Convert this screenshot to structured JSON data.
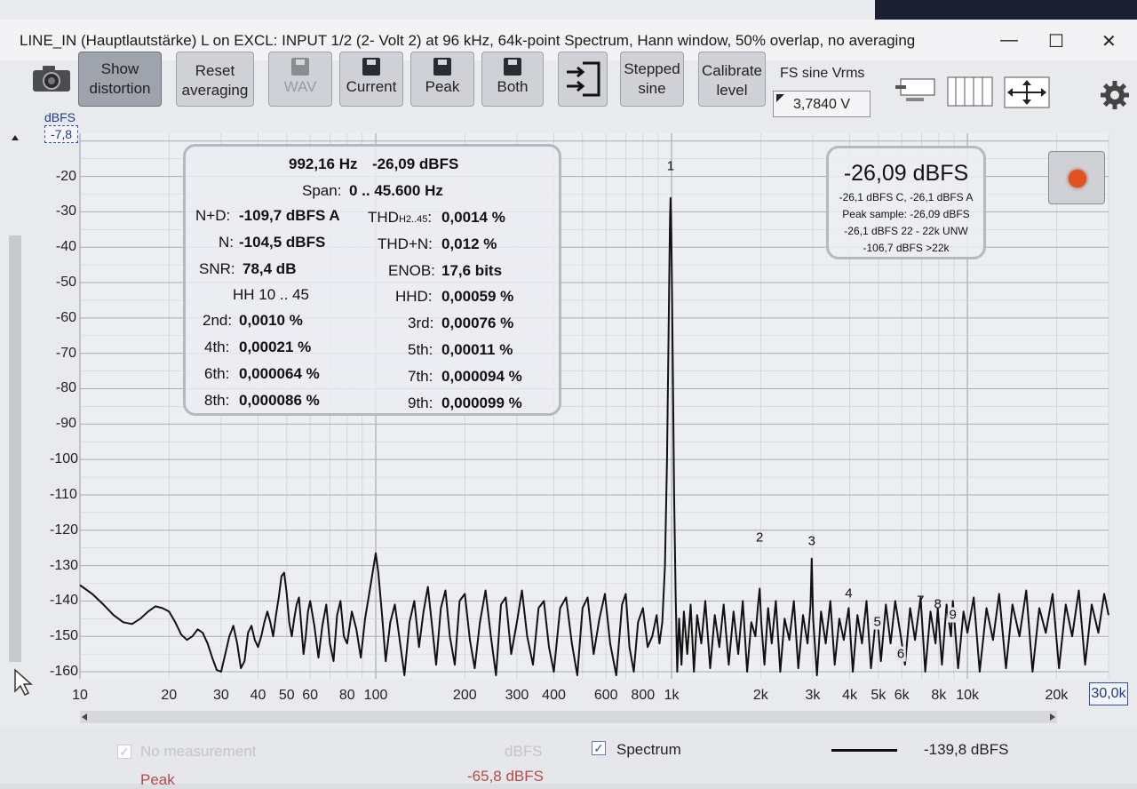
{
  "window": {
    "title": "LINE_IN (Hauptlautstärke) L on EXCL: INPUT 1/2 (2- Volt 2) at 96 kHz, 64k-point Spectrum, Hann window, 50% overlap, no averaging",
    "minimize": "—",
    "maximize": "☐",
    "close": "✕"
  },
  "toolbar": {
    "show_distortion": [
      "Show",
      "distortion"
    ],
    "reset_averaging": [
      "Reset",
      "averaging"
    ],
    "wav": "WAV",
    "current": "Current",
    "peak": "Peak",
    "both": "Both",
    "stepped_sine": [
      "Stepped",
      "sine"
    ],
    "calibrate_level": [
      "Calibrate",
      "level"
    ],
    "fs_label": "FS sine Vrms",
    "fs_value": "3,7840 V"
  },
  "chart_axis": {
    "y_unit": "dBFS",
    "y_top_value": "-7,8",
    "x_max_value": "30,0k"
  },
  "info": {
    "freq": "992,16 Hz",
    "level": "-26,09 dBFS",
    "span_label": "Span:",
    "span_value": "0 .. 45.600 Hz",
    "nd_label": "N+D:",
    "nd_value": "-109,7 dBFS A",
    "thd_label": "THD",
    "thd_sub": "H2..45",
    "thd_value": "0,0014 %",
    "n_label": "N:",
    "n_value": "-104,5 dBFS",
    "thdn_label": "THD+N:",
    "thdn_value": "0,012 %",
    "snr_label": "SNR:",
    "snr_value": "78,4 dB",
    "enob_label": "ENOB:",
    "enob_value": "17,6 bits",
    "hh_label": "HH 10 .. 45",
    "hhd_label": "HHD:",
    "hhd_value": "0,00059 %",
    "h2_label": "2nd:",
    "h2_value": "0,0010 %",
    "h3_label": "3rd:",
    "h3_value": "0,00076 %",
    "h4_label": "4th:",
    "h4_value": "0,00021 %",
    "h5_label": "5th:",
    "h5_value": "0,00011 %",
    "h6_label": "6th:",
    "h6_value": "0,000064 %",
    "h7_label": "7th:",
    "h7_value": "0,000094 %",
    "h8_label": "8th:",
    "h8_value": "0,000086 %",
    "h9_label": "9th:",
    "h9_value": "0,000099 %"
  },
  "peak_panel": {
    "main": "-26,09 dBFS",
    "line1": "-26,1 dBFS C, -26,1 dBFS A",
    "line2": "Peak sample: -26,09 dBFS",
    "line3": "-26,1 dBFS 22 - 22k UNW",
    "line4": "-106,7 dBFS >22k"
  },
  "footer": {
    "no_measurement": "No measurement",
    "dbfs_dim": "dBFS",
    "peak": "Peak",
    "peak_value": "-65,8 dBFS",
    "spectrum": "Spectrum",
    "spectrum_value": "-139,8 dBFS"
  },
  "chart_data": {
    "type": "line",
    "xscale": "log",
    "xlim": [
      10,
      30000
    ],
    "ylim": [
      -162,
      -7.8
    ],
    "x_ticks": [
      "10",
      "20",
      "30",
      "40",
      "50",
      "60",
      "80",
      "100",
      "200",
      "300",
      "400",
      "600",
      "800",
      "1k",
      "2k",
      "3k",
      "4k",
      "5k",
      "6k",
      "8k",
      "10k",
      "20k"
    ],
    "x_tick_values": [
      10,
      20,
      30,
      40,
      50,
      60,
      80,
      100,
      200,
      300,
      400,
      600,
      800,
      1000,
      2000,
      3000,
      4000,
      5000,
      6000,
      8000,
      10000,
      20000
    ],
    "y_ticks": [
      "-20",
      "-30",
      "-40",
      "-50",
      "-60",
      "-70",
      "-80",
      "-90",
      "-100",
      "-110",
      "-120",
      "-130",
      "-140",
      "-150",
      "-160"
    ],
    "y_tick_values": [
      -20,
      -30,
      -40,
      -50,
      -60,
      -70,
      -80,
      -90,
      -100,
      -110,
      -120,
      -130,
      -140,
      -150,
      -160
    ],
    "grid": true,
    "colors": {
      "trace": "#111111",
      "grid_major": "#a9acb3",
      "grid_minor": "#cfd1d6",
      "background": "#eceef1"
    },
    "harmonics": [
      {
        "label": "1",
        "x": 992,
        "y": -26.09,
        "marker_y": -17,
        "box": false
      },
      {
        "label": "2",
        "x": 1984,
        "y": -136.5,
        "marker_y": -122,
        "box": false
      },
      {
        "label": "3",
        "x": 2976,
        "y": -138,
        "marker_y": -123,
        "box": false
      },
      {
        "label": "4",
        "x": 3968,
        "y": -142,
        "marker_y": -138,
        "box": false
      },
      {
        "label": "5",
        "x": 4960,
        "y": -145,
        "marker_y": -146,
        "box": true
      },
      {
        "label": "6",
        "x": 5952,
        "y": -150,
        "marker_y": -155,
        "box": true
      },
      {
        "label": "7",
        "x": 6944,
        "y": -142,
        "marker_y": -140,
        "box": false
      },
      {
        "label": "8",
        "x": 7936,
        "y": -142,
        "marker_y": -141,
        "box": false
      },
      {
        "label": "9",
        "x": 8928,
        "y": -141,
        "marker_y": -144,
        "box": true
      }
    ],
    "series": [
      {
        "points": [
          [
            10,
            -135.5
          ],
          [
            11,
            -138
          ],
          [
            12,
            -141
          ],
          [
            13,
            -144
          ],
          [
            14,
            -146
          ],
          [
            15,
            -146.5
          ],
          [
            16,
            -145
          ],
          [
            17,
            -143
          ],
          [
            18,
            -141.5
          ],
          [
            19,
            -142
          ],
          [
            20,
            -143
          ],
          [
            21,
            -146
          ],
          [
            22,
            -149.5
          ],
          [
            23,
            -151
          ],
          [
            24,
            -150
          ],
          [
            25,
            -148
          ],
          [
            26,
            -149
          ],
          [
            27,
            -152
          ],
          [
            28,
            -156
          ],
          [
            29,
            -159.5
          ],
          [
            30,
            -160
          ],
          [
            31,
            -155
          ],
          [
            32,
            -150
          ],
          [
            33,
            -147
          ],
          [
            34,
            -152
          ],
          [
            35,
            -159
          ],
          [
            36,
            -157
          ],
          [
            37,
            -149
          ],
          [
            38,
            -147
          ],
          [
            39,
            -151
          ],
          [
            40,
            -153
          ],
          [
            41,
            -150
          ],
          [
            42,
            -146
          ],
          [
            43,
            -143
          ],
          [
            44,
            -146
          ],
          [
            45,
            -150
          ],
          [
            46,
            -144
          ],
          [
            47,
            -139
          ],
          [
            48,
            -133
          ],
          [
            49,
            -132
          ],
          [
            50,
            -138
          ],
          [
            51,
            -146
          ],
          [
            52,
            -150
          ],
          [
            53,
            -145
          ],
          [
            54,
            -141
          ],
          [
            55,
            -139
          ],
          [
            56,
            -147
          ],
          [
            57,
            -155
          ],
          [
            58,
            -150
          ],
          [
            59,
            -143
          ],
          [
            60,
            -140
          ],
          [
            62,
            -147
          ],
          [
            64,
            -156
          ],
          [
            66,
            -147
          ],
          [
            68,
            -141
          ],
          [
            70,
            -152
          ],
          [
            72,
            -157
          ],
          [
            74,
            -144
          ],
          [
            76,
            -140
          ],
          [
            78,
            -150
          ],
          [
            80,
            -152
          ],
          [
            83,
            -143
          ],
          [
            86,
            -148
          ],
          [
            89,
            -156
          ],
          [
            92,
            -145
          ],
          [
            95,
            -138
          ],
          [
            98,
            -131
          ],
          [
            100,
            -126.5
          ],
          [
            102,
            -132
          ],
          [
            105,
            -144
          ],
          [
            108,
            -157
          ],
          [
            112,
            -146
          ],
          [
            116,
            -141
          ],
          [
            120,
            -150
          ],
          [
            125,
            -161
          ],
          [
            130,
            -146
          ],
          [
            135,
            -140
          ],
          [
            140,
            -153
          ],
          [
            145,
            -143
          ],
          [
            150,
            -136
          ],
          [
            155,
            -147
          ],
          [
            160,
            -158
          ],
          [
            166,
            -142
          ],
          [
            172,
            -137
          ],
          [
            178,
            -150
          ],
          [
            185,
            -158
          ],
          [
            192,
            -140
          ],
          [
            200,
            -138
          ],
          [
            208,
            -151
          ],
          [
            216,
            -159
          ],
          [
            225,
            -146
          ],
          [
            235,
            -137
          ],
          [
            245,
            -150
          ],
          [
            255,
            -161
          ],
          [
            265,
            -141
          ],
          [
            275,
            -139
          ],
          [
            287,
            -155
          ],
          [
            300,
            -146
          ],
          [
            312,
            -137
          ],
          [
            325,
            -150
          ],
          [
            340,
            -158
          ],
          [
            355,
            -142
          ],
          [
            370,
            -140
          ],
          [
            385,
            -153
          ],
          [
            400,
            -160
          ],
          [
            420,
            -142
          ],
          [
            440,
            -139
          ],
          [
            460,
            -152
          ],
          [
            480,
            -161
          ],
          [
            500,
            -142
          ],
          [
            520,
            -139
          ],
          [
            545,
            -155
          ],
          [
            570,
            -145
          ],
          [
            595,
            -138
          ],
          [
            620,
            -152
          ],
          [
            650,
            -161
          ],
          [
            680,
            -141
          ],
          [
            700,
            -138
          ],
          [
            720,
            -153
          ],
          [
            745,
            -160
          ],
          [
            770,
            -146
          ],
          [
            800,
            -142
          ],
          [
            830,
            -153
          ],
          [
            860,
            -150
          ],
          [
            890,
            -144
          ],
          [
            910,
            -152
          ],
          [
            930,
            -146
          ],
          [
            950,
            -130
          ],
          [
            965,
            -100
          ],
          [
            975,
            -70
          ],
          [
            983,
            -45
          ],
          [
            988,
            -32
          ],
          [
            992,
            -26.09
          ],
          [
            996,
            -32
          ],
          [
            1001,
            -45
          ],
          [
            1010,
            -75
          ],
          [
            1020,
            -110
          ],
          [
            1032,
            -138
          ],
          [
            1045,
            -160
          ],
          [
            1060,
            -145
          ],
          [
            1080,
            -158
          ],
          [
            1100,
            -143
          ],
          [
            1130,
            -155
          ],
          [
            1160,
            -141
          ],
          [
            1190,
            -160
          ],
          [
            1220,
            -144
          ],
          [
            1260,
            -152
          ],
          [
            1300,
            -140
          ],
          [
            1350,
            -159
          ],
          [
            1400,
            -144
          ],
          [
            1450,
            -153
          ],
          [
            1500,
            -141
          ],
          [
            1560,
            -158
          ],
          [
            1620,
            -143
          ],
          [
            1680,
            -155
          ],
          [
            1740,
            -140
          ],
          [
            1800,
            -160
          ],
          [
            1860,
            -146
          ],
          [
            1920,
            -150
          ],
          [
            1960,
            -141
          ],
          [
            1984,
            -136.5
          ],
          [
            2010,
            -146
          ],
          [
            2060,
            -158
          ],
          [
            2120,
            -142
          ],
          [
            2180,
            -152
          ],
          [
            2250,
            -140
          ],
          [
            2330,
            -160
          ],
          [
            2410,
            -145
          ],
          [
            2500,
            -151
          ],
          [
            2590,
            -140
          ],
          [
            2680,
            -159
          ],
          [
            2780,
            -144
          ],
          [
            2880,
            -152
          ],
          [
            2950,
            -141
          ],
          [
            2976,
            -128
          ],
          [
            3010,
            -145
          ],
          [
            3100,
            -161
          ],
          [
            3200,
            -143
          ],
          [
            3320,
            -152
          ],
          [
            3440,
            -140
          ],
          [
            3560,
            -158
          ],
          [
            3690,
            -145
          ],
          [
            3820,
            -151
          ],
          [
            3968,
            -142
          ],
          [
            4100,
            -160
          ],
          [
            4250,
            -144
          ],
          [
            4400,
            -152
          ],
          [
            4560,
            -140
          ],
          [
            4720,
            -159
          ],
          [
            4890,
            -146
          ],
          [
            4960,
            -145
          ],
          [
            5100,
            -157
          ],
          [
            5300,
            -141
          ],
          [
            5500,
            -152
          ],
          [
            5700,
            -140
          ],
          [
            5952,
            -150
          ],
          [
            6150,
            -158
          ],
          [
            6400,
            -142
          ],
          [
            6650,
            -151
          ],
          [
            6944,
            -139
          ],
          [
            7200,
            -160
          ],
          [
            7500,
            -143
          ],
          [
            7800,
            -152
          ],
          [
            7936,
            -142
          ],
          [
            8200,
            -158
          ],
          [
            8500,
            -141
          ],
          [
            8800,
            -150
          ],
          [
            8928,
            -140
          ],
          [
            9300,
            -159
          ],
          [
            9700,
            -143
          ],
          [
            10000,
            -149
          ],
          [
            10500,
            -139
          ],
          [
            11000,
            -160
          ],
          [
            11600,
            -142
          ],
          [
            12200,
            -151
          ],
          [
            12800,
            -138
          ],
          [
            13500,
            -159
          ],
          [
            14200,
            -141
          ],
          [
            15000,
            -150
          ],
          [
            15800,
            -137
          ],
          [
            16600,
            -160
          ],
          [
            17500,
            -142
          ],
          [
            18400,
            -149
          ],
          [
            19400,
            -138
          ],
          [
            20400,
            -159
          ],
          [
            21500,
            -141
          ],
          [
            22600,
            -150
          ],
          [
            23800,
            -137
          ],
          [
            25000,
            -158
          ],
          [
            26300,
            -141
          ],
          [
            27700,
            -149
          ],
          [
            29000,
            -138
          ],
          [
            30000,
            -144
          ]
        ]
      }
    ]
  }
}
